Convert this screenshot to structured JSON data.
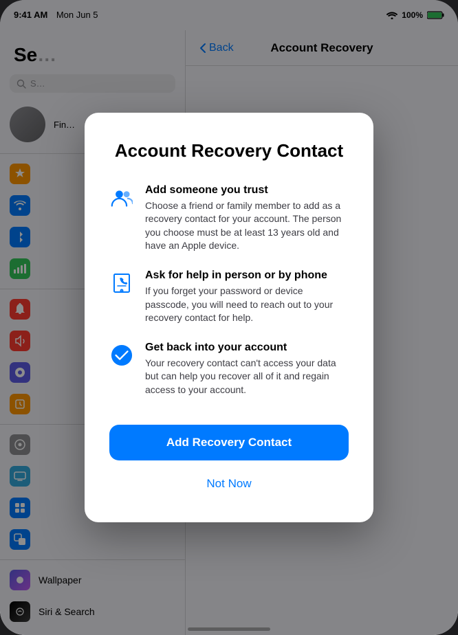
{
  "statusBar": {
    "time": "9:41 AM",
    "date": "Mon Jun 5",
    "wifi": "100%",
    "battery": "100%"
  },
  "sidebar": {
    "title": "Se…",
    "searchPlaceholder": "S…",
    "profileLabel": "Fin…",
    "items": [
      {
        "id": "airplane",
        "label": "",
        "color": "#ff9500"
      },
      {
        "id": "wifi",
        "label": "",
        "color": "#007aff"
      },
      {
        "id": "bluetooth",
        "label": "",
        "color": "#007aff"
      },
      {
        "id": "cellular",
        "label": "",
        "color": "#34c759"
      },
      {
        "id": "notif",
        "label": "",
        "color": "#ff3b30"
      },
      {
        "id": "sounds",
        "label": "",
        "color": "#ff3b30"
      },
      {
        "id": "focus",
        "label": "",
        "color": "#5e5ce6"
      },
      {
        "id": "screen",
        "label": "",
        "color": "#ff9500"
      },
      {
        "id": "general",
        "label": "",
        "color": "#8e8e93"
      },
      {
        "id": "display",
        "label": "",
        "color": "#34aadc"
      },
      {
        "id": "home",
        "label": "",
        "color": "#007aff"
      },
      {
        "id": "multi",
        "label": "",
        "color": "#007aff"
      },
      {
        "id": "wallpaper",
        "label": "Wallpaper",
        "color": "#5e5ce6"
      },
      {
        "id": "siri",
        "label": "Siri & Search",
        "color": "#000"
      }
    ]
  },
  "navBar": {
    "backLabel": "Back",
    "title": "Account Recovery"
  },
  "modal": {
    "title": "Account Recovery Contact",
    "features": [
      {
        "id": "trust",
        "title": "Add someone you trust",
        "description": "Choose a friend or family member to add as a recovery contact for your account. The person you choose must be at least 13 years old and have an Apple device."
      },
      {
        "id": "phone",
        "title": "Ask for help in person or by phone",
        "description": "If you forget your password or device passcode, you will need to reach out to your recovery contact for help."
      },
      {
        "id": "recover",
        "title": "Get back into your account",
        "description": "Your recovery contact can't access your data but can help you recover all of it and regain access to your account."
      }
    ],
    "primaryButton": "Add Recovery Contact",
    "secondaryButton": "Not Now"
  }
}
